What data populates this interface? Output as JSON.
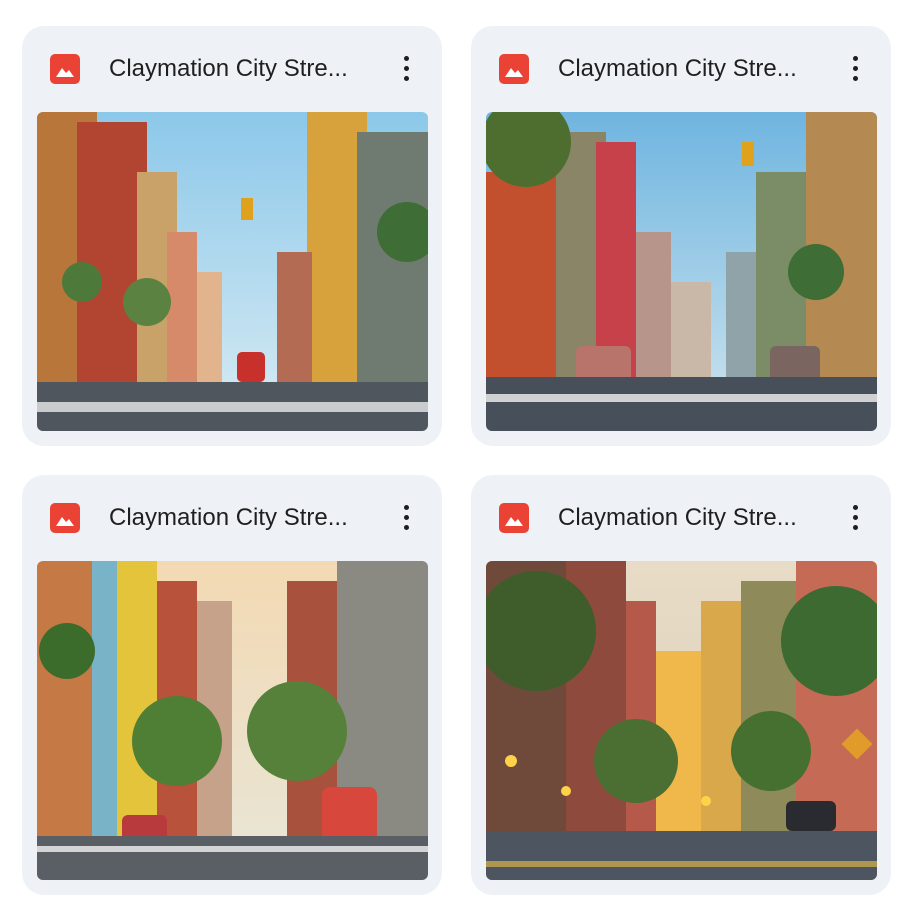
{
  "cards": [
    {
      "title": "Claymation City Stre...",
      "icon": "image-file-icon",
      "menu_icon": "more-vert-icon",
      "thumbnail": "claymation city street scene, sunny with traffic light and red car"
    },
    {
      "title": "Claymation City Stre...",
      "icon": "image-file-icon",
      "menu_icon": "more-vert-icon",
      "thumbnail": "claymation city street scene, blue sky with colorful buildings"
    },
    {
      "title": "Claymation City Stre...",
      "icon": "image-file-icon",
      "menu_icon": "more-vert-icon",
      "thumbnail": "claymation city street scene, warm light with red bus and trees"
    },
    {
      "title": "Claymation City Stre...",
      "icon": "image-file-icon",
      "menu_icon": "more-vert-icon",
      "thumbnail": "claymation city street scene, dusk with street lamps and trees"
    }
  ],
  "colors": {
    "card_bg": "#eef1f6",
    "icon_red": "#ea4335",
    "text": "#1f1f1f"
  }
}
